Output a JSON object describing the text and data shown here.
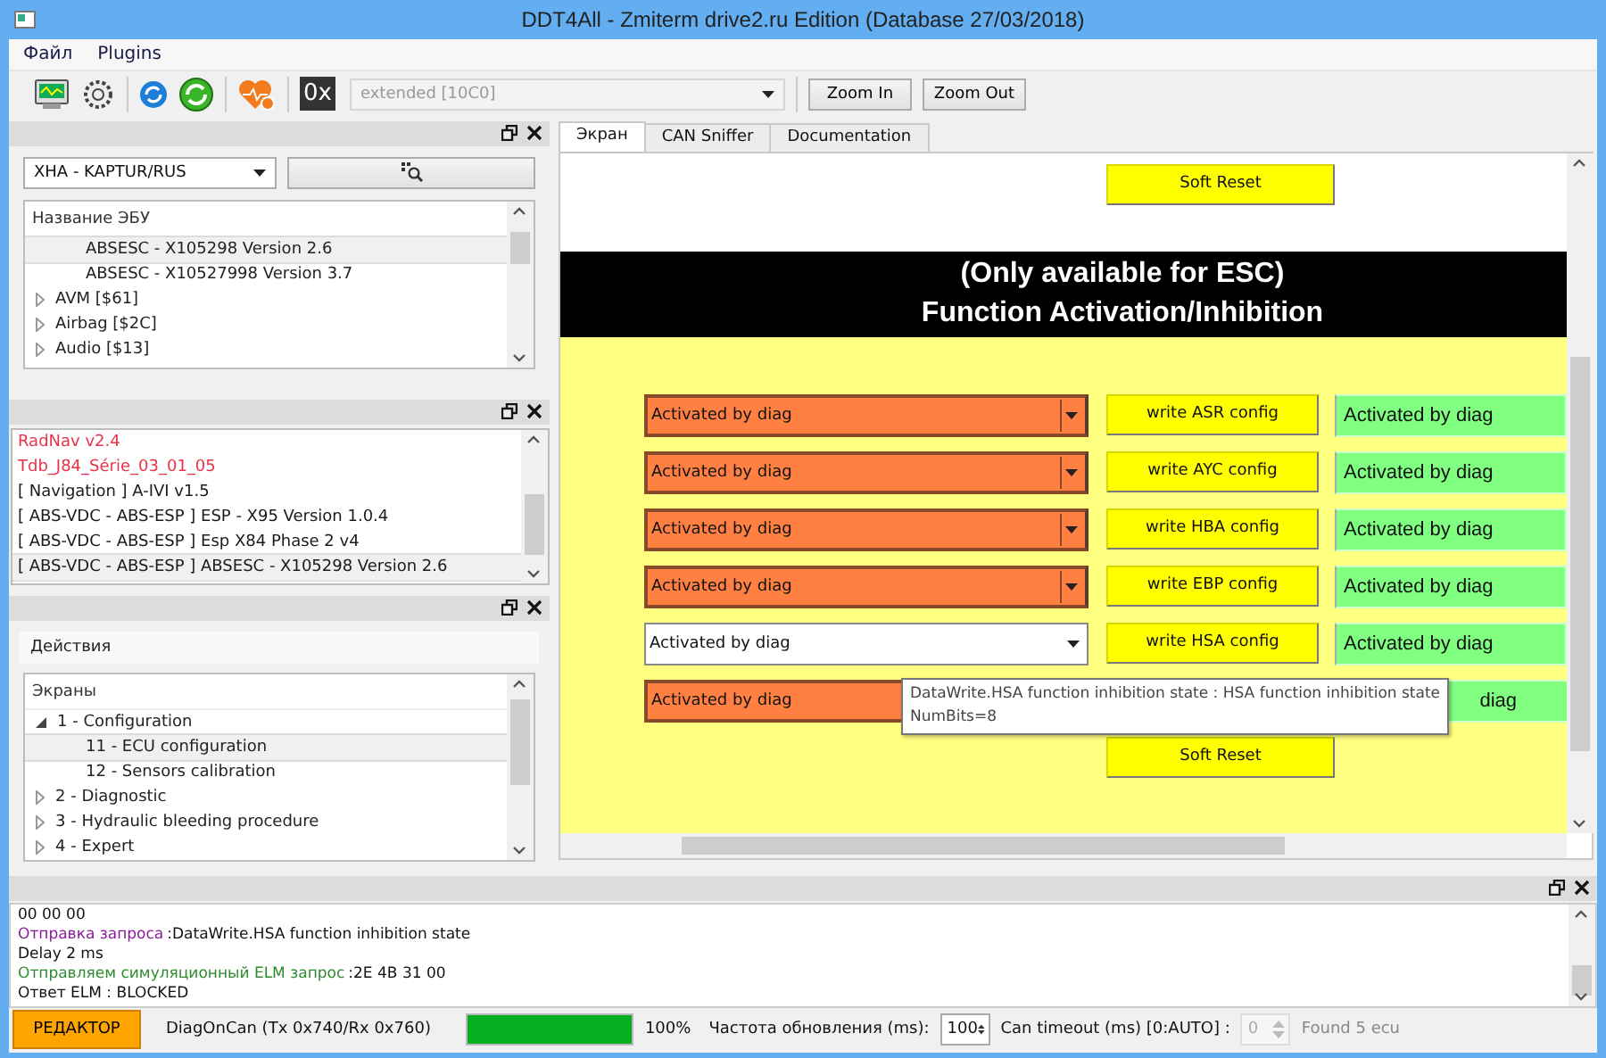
{
  "window": {
    "title": "DDT4All - Zmiterm drive2.ru Edition (Database 27/03/2018)"
  },
  "menu": [
    "Файл",
    "Plugins"
  ],
  "toolbar": {
    "hex_label": "0x",
    "mode_combo": {
      "value": "extended [10C0]",
      "disabled": true
    },
    "buttons": [
      "Zoom In",
      "Zoom Out"
    ]
  },
  "ecu_panel": {
    "vehicle_combo": "XHA - KAPTUR/RUS",
    "tree": {
      "header": "Название ЭБУ",
      "items": [
        {
          "children": [
            {
              "label": "ABSESC - X105298 Version 2.6",
              "selected": true
            },
            {
              "label": "ABSESC - X10527998 Version 3.7",
              "selected": false
            }
          ]
        },
        {
          "label": "AVM [$61]",
          "expanded": false,
          "selected": false
        },
        {
          "label": "Airbag [$2C]",
          "expanded": false,
          "selected": false
        },
        {
          "label": "Audio [$13]",
          "expanded": false,
          "selected": false
        }
      ]
    }
  },
  "found_ecus": [
    {
      "label": "RadNav v2.4",
      "color": "#e8334a",
      "selected": false
    },
    {
      "label": "Tdb_J84_Série_03_01_05",
      "color": "#e8334a",
      "selected": false
    },
    {
      "label": "[ Navigation ] A-IVI v1.5",
      "color": "#1a1a1a",
      "selected": false
    },
    {
      "label": "[ ABS-VDC - ABS-ESP ] ESP - X95 Version 1.0.4",
      "color": "#1a1a1a",
      "selected": false
    },
    {
      "label": "[ ABS-VDC - ABS-ESP ] Esp X84 Phase 2 v4",
      "color": "#1a1a1a",
      "selected": false
    },
    {
      "label": "[ ABS-VDC - ABS-ESP ] ABSESC - X105298 Version 2.6",
      "color": "#1a1a1a",
      "selected": true
    }
  ],
  "actions_panel": {
    "tab": "Действия",
    "tree": {
      "header": "Экраны",
      "items": [
        {
          "label": "1 - Configuration",
          "expanded": true,
          "selected": false,
          "children": [
            {
              "label": "11 - ECU configuration",
              "selected": true
            },
            {
              "label": "12 - Sensors calibration",
              "selected": false
            }
          ]
        },
        {
          "label": "2 - Diagnostic",
          "expanded": false,
          "selected": false
        },
        {
          "label": "3 - Hydraulic bleeding procedure",
          "expanded": false,
          "selected": false
        },
        {
          "label": "4 - Expert",
          "expanded": false,
          "selected": false
        }
      ]
    }
  },
  "tabs": [
    {
      "label": "Экран",
      "selected": true
    },
    {
      "label": "CAN Sniffer",
      "selected": false
    },
    {
      "label": "Documentation",
      "selected": false
    }
  ],
  "screen": {
    "top_button": "Soft Reset",
    "banner": [
      "(Only available for ESC)",
      "Function Activation/Inhibition"
    ],
    "rows": [
      {
        "value": "Activated by diag",
        "highlighted": true,
        "button": "write ASR config",
        "result": "Activated by diag"
      },
      {
        "value": "Activated by diag",
        "highlighted": true,
        "button": "write AYC config",
        "result": "Activated by diag"
      },
      {
        "value": "Activated by diag",
        "highlighted": true,
        "button": "write HBA config",
        "result": "Activated by diag"
      },
      {
        "value": "Activated by diag",
        "highlighted": true,
        "button": "write EBP config",
        "result": "Activated by diag"
      },
      {
        "value": "Activated by diag",
        "highlighted": false,
        "button": "write HSA config",
        "result": "Activated by diag"
      },
      {
        "value": "Activated by diag",
        "highlighted": true,
        "result": "diag",
        "tooltip": [
          "DataWrite.HSA function inhibition state : HSA function inhibition state",
          "NumBits=8"
        ]
      }
    ],
    "bottom_button": "Soft Reset"
  },
  "log": [
    {
      "text": "00 00 00"
    },
    {
      "kind": "request",
      "label": "Отправка запроса",
      "text": ":DataWrite.HSA function inhibition state"
    },
    {
      "text": "Delay 2 ms"
    },
    {
      "kind": "elm",
      "label": "Отправляем симуляционный ELM запрос",
      "text": ":2E 4B 31 00"
    },
    {
      "text": "Ответ ELM : BLOCKED"
    }
  ],
  "status_bar": {
    "editor_button": "РЕДАКТОР",
    "connection": "DiagOnCan (Tx 0x740/Rx 0x760)",
    "progress": {
      "level": 1.0
    },
    "percent": "100%",
    "refresh_label": "Частота обновления (ms):",
    "refresh_value": "100",
    "timeout_label": "Can timeout (ms) [0:AUTO] :",
    "timeout_value": {
      "value": "0",
      "disabled": true
    },
    "found": "Found 5 ecu"
  }
}
